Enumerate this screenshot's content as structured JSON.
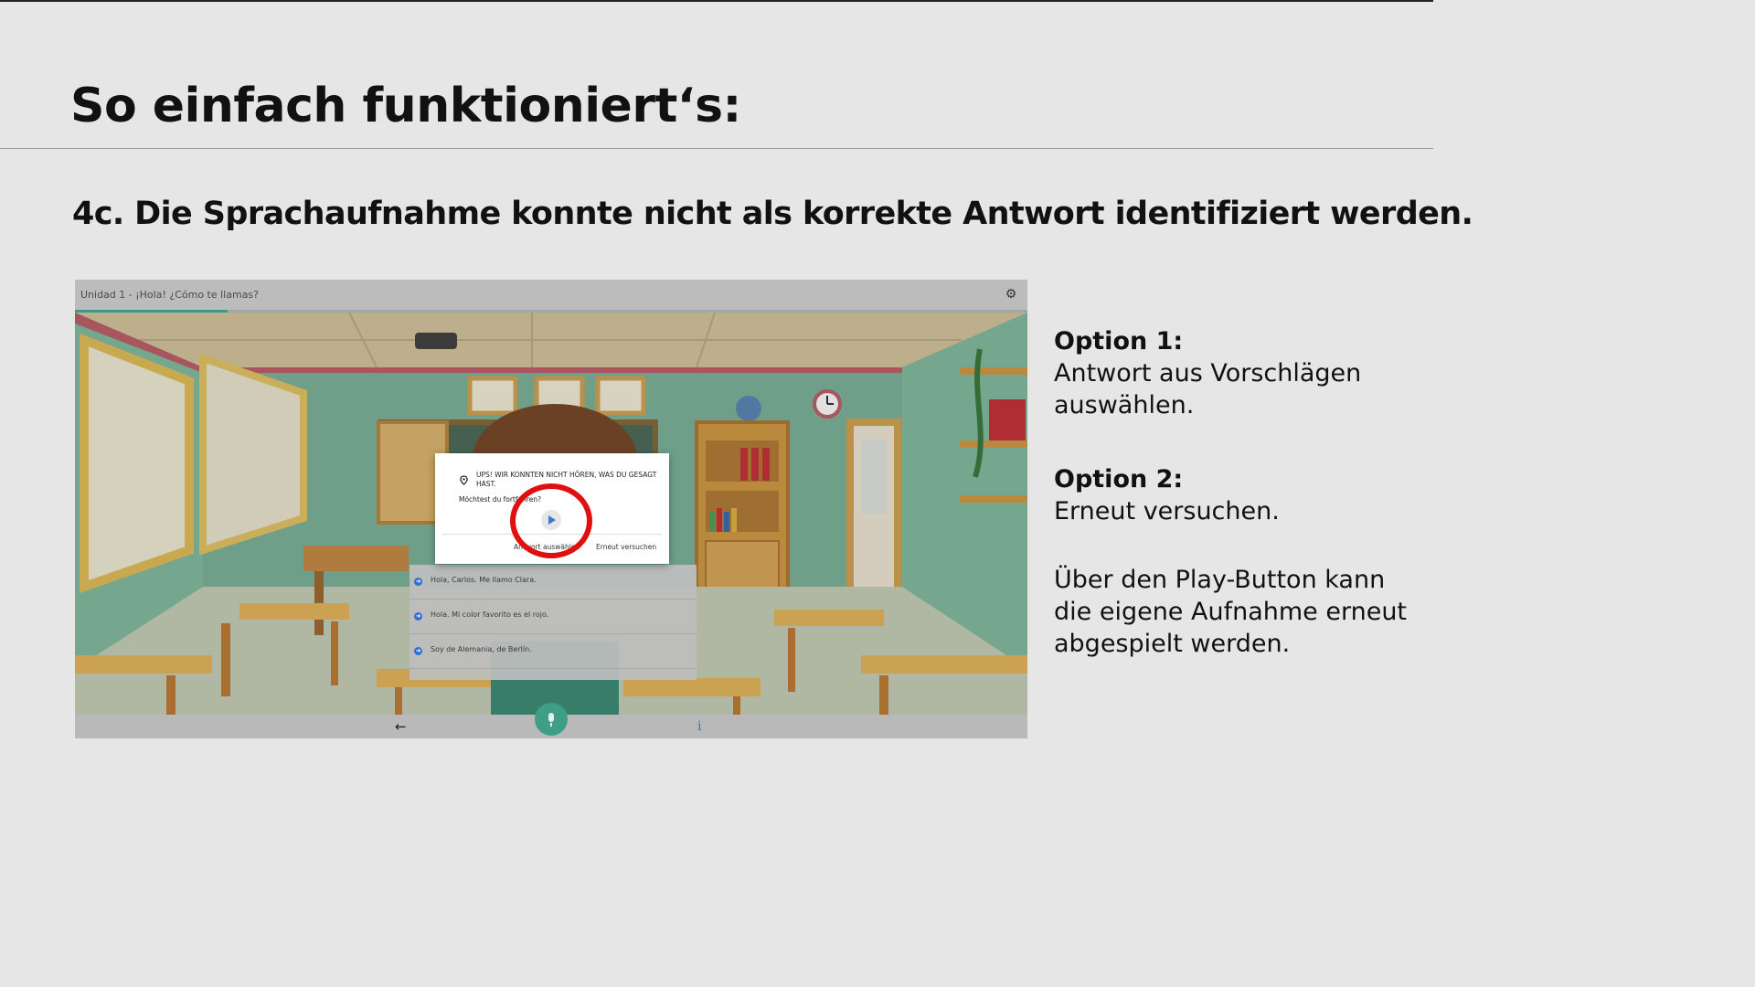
{
  "slide": {
    "title": "So einfach funktioniert‘s:",
    "step_heading": "4c. Die Sprachaufnahme konnte nicht als korrekte Antwort identifiziert werden."
  },
  "app": {
    "header_title": "Unidad 1 - ¡Hola! ¿Cómo te llamas?",
    "settings_icon": "gear-icon",
    "progress": 0.16,
    "dialog": {
      "title": "Ups! Wir konnten nicht hören, was du gesagt hast.",
      "question": "Möchtest du fortfahren?",
      "play_icon": "play-icon",
      "choose_button": "Antwort auswählen",
      "retry_button": "Erneut versuchen"
    },
    "answers": [
      {
        "text": "Hola, Carlos. Me llamo Clara."
      },
      {
        "text": "Hola. Mi color favorito es el rojo."
      },
      {
        "text": "Soy de Alemania, de Berlín."
      }
    ],
    "footer": {
      "back_icon": "arrow-left-icon",
      "mic_icon": "microphone-icon",
      "info_icon": "info-icon"
    },
    "colors": {
      "accent": "#3f9f86",
      "highlight": "#e01010",
      "link": "#2f6fd6"
    }
  },
  "side": {
    "option1_label": "Option 1:",
    "option1_text": "Antwort aus Vorschlägen auswählen.",
    "option2_label": "Option 2:",
    "option2_text": "Erneut versuchen.",
    "note": "Über den Play-Button kann die eigene Aufnahme erneut abgespielt werden."
  }
}
